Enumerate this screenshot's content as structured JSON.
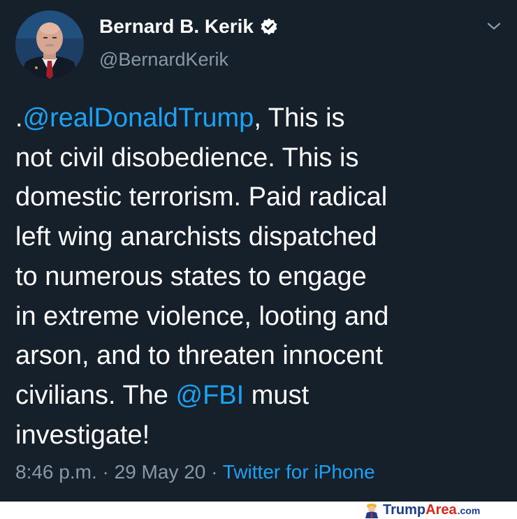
{
  "tweet": {
    "display_name": "Bernard B. Kerik",
    "handle": "@BernardKerik",
    "text_lines": [
      [
        ".",
        "@realDonaldTrump",
        ", This is"
      ],
      "not civil disobedience. This is",
      "domestic terrorism. Paid radical",
      "left wing anarchists dispatched",
      "to numerous states to engage",
      "in extreme violence, looting and",
      "arson, and to threaten innocent",
      [
        "civilians. The ",
        "@FBI",
        " must"
      ],
      "investigate!"
    ],
    "time": "8:46 p.m.",
    "separator": " · ",
    "date": "29 May 20",
    "source": "Twitter for iPhone"
  },
  "icons": {
    "verified": "verified-badge-icon",
    "menu": "chevron-down-icon",
    "avatar": "profile-photo"
  },
  "colors": {
    "background": "#15202b",
    "text": "#ffffff",
    "secondary_text": "#8899a6",
    "link": "#1da1f2"
  },
  "watermark": {
    "brand_part1": "Trump",
    "brand_part2": "Area",
    "suffix": ".com",
    "color_primary": "#1a3d8f",
    "color_accent": "#d8261c"
  }
}
